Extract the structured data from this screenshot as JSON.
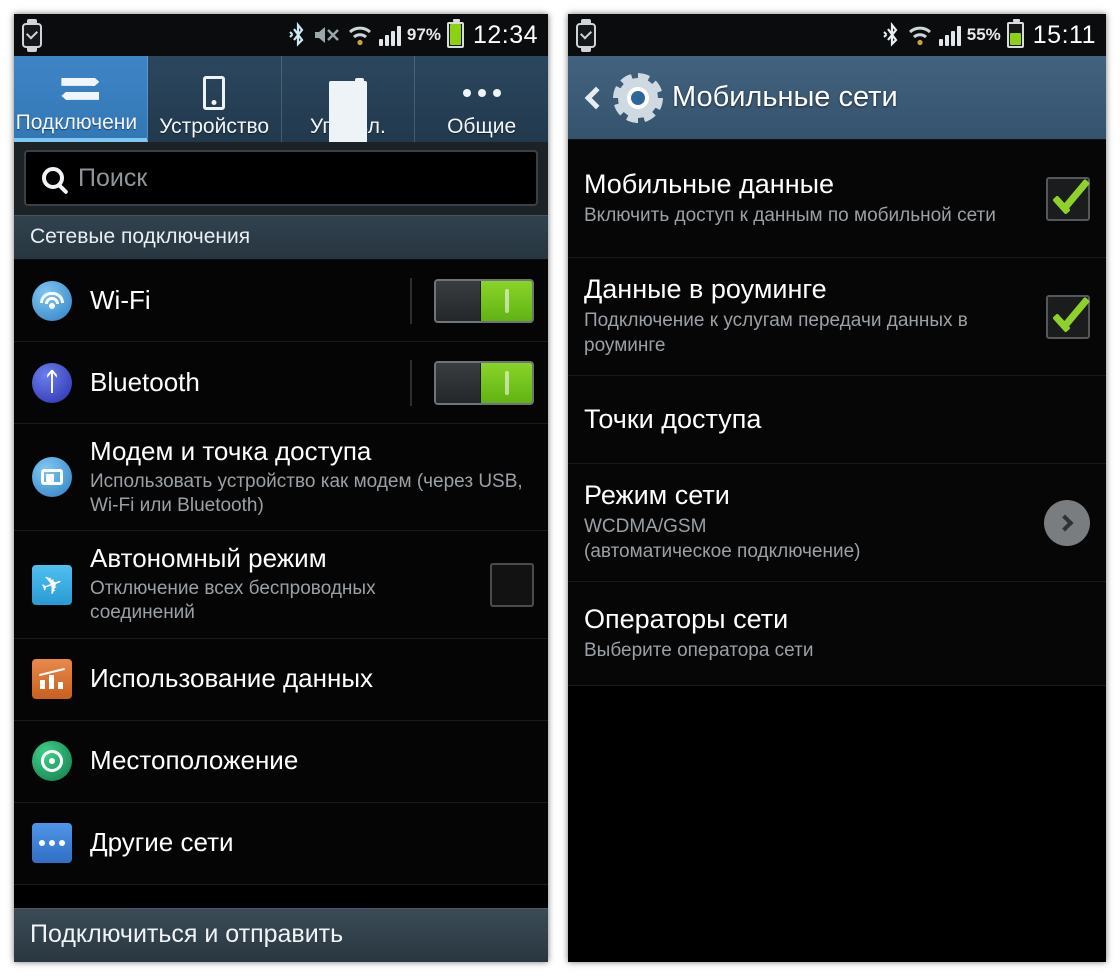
{
  "left_phone": {
    "status_bar": {
      "watch_icon": "smartwatch-icon",
      "bluetooth_icon": "bluetooth-icon",
      "mute_icon": "speaker-mute-icon",
      "wifi_icon": "wifi-icon",
      "signal_icon": "signal-bars-icon",
      "battery_percent": "97%",
      "battery_level": 97,
      "time": "12:34"
    },
    "tabs": [
      {
        "label": "Подключени",
        "icon": "connections-arrows-icon",
        "active": true
      },
      {
        "label": "Устройство",
        "icon": "phone-device-icon",
        "active": false
      },
      {
        "label": "Управл.",
        "icon": "sliders-icon",
        "active": false
      },
      {
        "label": "Общие",
        "icon": "more-dots-icon",
        "active": false
      }
    ],
    "search": {
      "placeholder": "Поиск",
      "value": "",
      "icon": "search-icon"
    },
    "section_header": "Сетевые подключения",
    "items": [
      {
        "title": "Wi-Fi",
        "subtitle": "",
        "icon": "wifi-round-icon",
        "control": "toggle",
        "state": "on"
      },
      {
        "title": "Bluetooth",
        "subtitle": "",
        "icon": "bluetooth-round-icon",
        "control": "toggle",
        "state": "on"
      },
      {
        "title": "Модем и точка доступа",
        "subtitle": "Использовать устройство как модем (через USB, Wi-Fi или Bluetooth)",
        "icon": "tethering-round-icon",
        "control": "none",
        "state": ""
      },
      {
        "title": "Автономный режим",
        "subtitle": "Отключение всех беспроводных соединений",
        "icon": "airplane-icon",
        "control": "checkbox",
        "state": "off"
      },
      {
        "title": "Использование данных",
        "subtitle": "",
        "icon": "data-usage-icon",
        "control": "none",
        "state": ""
      },
      {
        "title": "Местоположение",
        "subtitle": "",
        "icon": "location-round-icon",
        "control": "none",
        "state": ""
      },
      {
        "title": "Другие сети",
        "subtitle": "",
        "icon": "other-networks-icon",
        "control": "none",
        "state": ""
      }
    ],
    "bottom_bar": "Подключиться и отправить"
  },
  "right_phone": {
    "status_bar": {
      "watch_icon": "smartwatch-icon",
      "bluetooth_icon": "bluetooth-icon",
      "wifi_icon": "wifi-icon",
      "signal_icon": "signal-bars-icon",
      "battery_percent": "55%",
      "battery_level": 55,
      "time": "15:11"
    },
    "app_bar": {
      "back_icon": "back-chevron-icon",
      "app_icon": "settings-gear-icon",
      "title": "Мобильные сети"
    },
    "items": [
      {
        "title": "Мобильные данные",
        "subtitle": "Включить доступ к данным по мобильной сети",
        "control": "checkbox",
        "state": "on"
      },
      {
        "title": "Данные в роуминге",
        "subtitle": "Подключение к услугам передачи данных в роуминге",
        "control": "checkbox",
        "state": "on"
      },
      {
        "title": "Точки доступа",
        "subtitle": "",
        "control": "none",
        "state": ""
      },
      {
        "title": "Режим сети",
        "subtitle": "WCDMA/GSM\n(автоматическое подключение)",
        "control": "chevron",
        "state": ""
      },
      {
        "title": "Операторы сети",
        "subtitle": "Выберите оператора сети",
        "control": "none",
        "state": ""
      }
    ]
  },
  "colors": {
    "accent_blue": "#3f85c6",
    "toggle_green": "#8ad42a",
    "check_green": "#8fd02b",
    "header_blue": "#35536d",
    "section_bg": "#31424f",
    "bg_black": "#000000"
  }
}
